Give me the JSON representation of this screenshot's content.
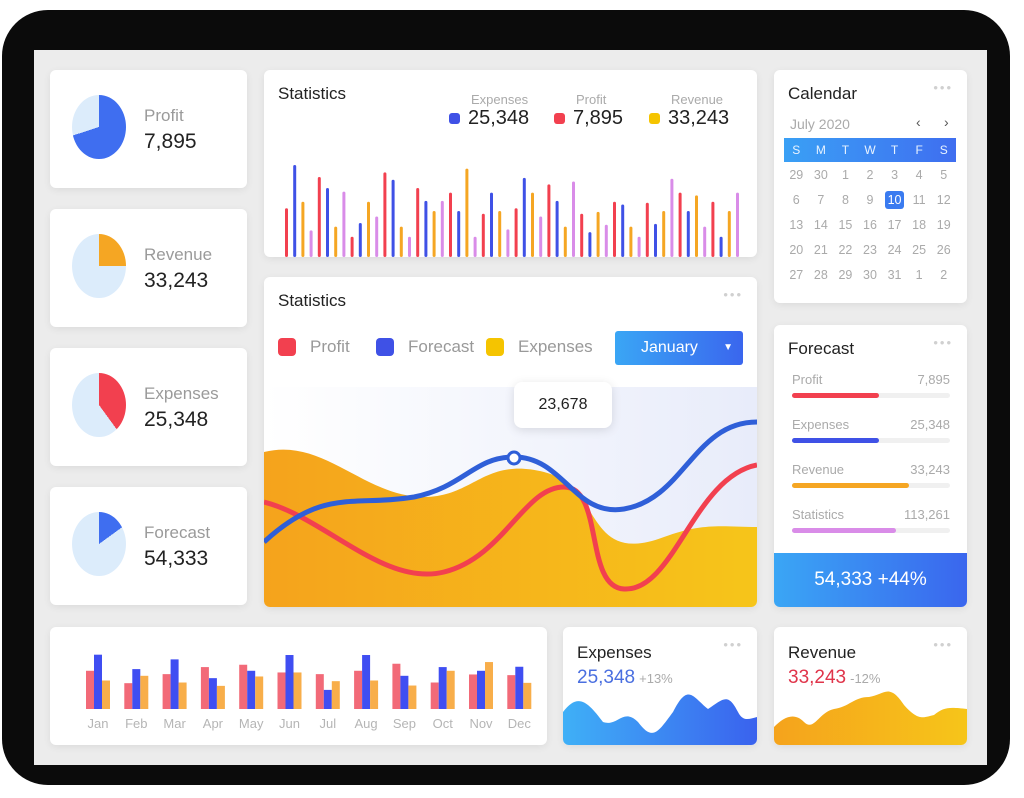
{
  "colors": {
    "profit": "#f2404f",
    "blue": "#3f51e6",
    "cyan": "#1da1e6",
    "orange": "#f5a623",
    "yellow": "#f5c400",
    "violet": "#d98ce8",
    "pie_bg": "#dcecfb"
  },
  "kpis": [
    {
      "label": "Profit",
      "value": "7,895",
      "color": "#3f6ef0",
      "fraction": 0.7
    },
    {
      "label": "Revenue",
      "value": "33,243",
      "color": "#f5a623",
      "fraction": 0.25
    },
    {
      "label": "Expenses",
      "value": "25,348",
      "color": "#f2404f",
      "fraction": 0.4
    },
    {
      "label": "Forecast",
      "value": "54,333",
      "color": "#3f6ef0",
      "fraction": 0.15
    }
  ],
  "stats_top": {
    "title": "Statistics",
    "legend": [
      {
        "name": "Expenses",
        "value": "25,348",
        "color": "#3f51e6"
      },
      {
        "name": "Profit",
        "value": "7,895",
        "color": "#f2404f"
      },
      {
        "name": "Revenue",
        "value": "33,243",
        "color": "#f5c400"
      }
    ]
  },
  "calendar": {
    "title": "Calendar",
    "month": "July 2020",
    "prev": "‹",
    "next": "›",
    "weekdays": [
      "S",
      "M",
      "T",
      "W",
      "T",
      "F",
      "S"
    ],
    "days": [
      "29",
      "30",
      "1",
      "2",
      "3",
      "4",
      "5",
      "6",
      "7",
      "8",
      "9",
      "10",
      "11",
      "12",
      "13",
      "14",
      "15",
      "16",
      "17",
      "18",
      "19",
      "20",
      "21",
      "22",
      "23",
      "24",
      "25",
      "26",
      "27",
      "28",
      "29",
      "30",
      "31",
      "1",
      "2"
    ],
    "selected": "10"
  },
  "stats_main": {
    "title": "Statistics",
    "legend": [
      {
        "name": "Profit",
        "color": "#f2404f"
      },
      {
        "name": "Forecast",
        "color": "#3f51e6"
      },
      {
        "name": "Expenses",
        "color": "#f5c400"
      }
    ],
    "dropdown": "January",
    "tooltip": "23,678"
  },
  "forecast": {
    "title": "Forecast",
    "rows": [
      {
        "name": "Profit",
        "value": "7,895",
        "pct": 55,
        "color": "#f2404f"
      },
      {
        "name": "Expenses",
        "value": "25,348",
        "pct": 55,
        "color": "#3f51e6"
      },
      {
        "name": "Revenue",
        "value": "33,243",
        "pct": 74,
        "color": "#f5a623"
      },
      {
        "name": "Statistics",
        "value": "113,261",
        "pct": 66,
        "color": "#d98ce8"
      }
    ],
    "footer": "54,333 +44%"
  },
  "mini_expenses": {
    "title": "Expenses",
    "value": "25,348",
    "change": "+13%",
    "color": "#3f6ef0"
  },
  "mini_revenue": {
    "title": "Revenue",
    "value": "33,243",
    "change": "-12%",
    "color": "#e0344a"
  },
  "chart_data": [
    {
      "type": "bar",
      "title": "Statistics",
      "series_colors": [
        "#f2404f",
        "#3f51e6",
        "#f5a623",
        "#d98ce8"
      ],
      "ylim": [
        0,
        100
      ],
      "values": [
        53,
        100,
        60,
        29,
        87,
        75,
        33,
        71,
        22,
        37,
        60,
        44,
        92,
        84,
        33,
        22,
        75,
        61,
        50,
        61,
        70,
        50,
        96,
        22,
        47,
        70,
        50,
        30,
        53,
        86,
        70,
        44,
        79,
        61,
        33,
        82,
        47,
        27,
        49,
        35,
        60,
        57,
        33,
        22,
        59,
        36,
        50,
        85,
        70,
        50,
        67,
        33,
        60,
        22,
        50,
        70
      ]
    },
    {
      "type": "bar",
      "categories": [
        "Jan",
        "Feb",
        "Mar",
        "Apr",
        "May",
        "Jun",
        "Jul",
        "Aug",
        "Sep",
        "Oct",
        "Nov",
        "Dec"
      ],
      "ylim": [
        0,
        170
      ],
      "series": [
        {
          "color": "#f26a78",
          "values": [
            114,
            77,
            104,
            125,
            132,
            109,
            104,
            114,
            135,
            79,
            103,
            101
          ]
        },
        {
          "color": "#3f4ef2",
          "values": [
            162,
            119,
            148,
            92,
            114,
            161,
            57,
            161,
            99,
            125,
            114,
            126
          ]
        },
        {
          "color": "#f8ae4a",
          "values": [
            85,
            99,
            79,
            69,
            97,
            109,
            83,
            85,
            70,
            114,
            140,
            78
          ]
        }
      ]
    }
  ]
}
